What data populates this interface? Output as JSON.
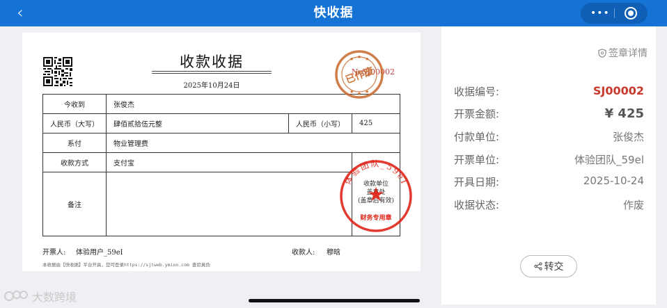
{
  "header": {
    "title": "快收据",
    "back_icon": "‹",
    "more_icon": "•••",
    "colors": {
      "bar": "#1673d6",
      "capsule": "#0f5fb6"
    }
  },
  "receipt": {
    "title": "收款收据",
    "date": "2025年10月24日",
    "number_label": "No",
    "number": "SJ00002",
    "rows": {
      "received_from_label": "今收到",
      "received_from": "张俊杰",
      "amount_upper_label": "人民币（大写）",
      "amount_upper": "肆佰贰拾伍元整",
      "amount_lower_label": "人民币（小写）",
      "amount_lower": "425",
      "for_label": "系付",
      "for_value": "物业管理费",
      "method_label": "收款方式",
      "method_value": "支付宝",
      "remark_label": "备注",
      "seal_note": "收款单位\n盖章处\n(盖章后有效)"
    },
    "issuer_label": "开票人:",
    "issuer": "体验用户_59eI",
    "payee_label": "收款人:",
    "payee": "穆晗",
    "footnote": "本收据由【快收据】平台开具，您可登录https://sjtweb.ymion.com 查验真伪",
    "void_stamp": {
      "text": "已作废"
    },
    "seal": {
      "ring_text": "体验团队_59eI",
      "bottom_text": "财务专用章"
    },
    "colors": {
      "stamp_orange": "#c8692c",
      "seal_red": "#e0251b",
      "number": "#c13b3b"
    }
  },
  "details": {
    "stamp_link": "签章详情",
    "items": [
      {
        "label": "收据编号:",
        "value": "SJ00002"
      },
      {
        "label": "开票金额:",
        "value": "¥ 425"
      },
      {
        "label": "付款单位:",
        "value": "张俊杰"
      },
      {
        "label": "开票单位:",
        "value": "体验团队_59el"
      },
      {
        "label": "开具日期:",
        "value": "2025-10-24"
      },
      {
        "label": "收据状态:",
        "value": "作废"
      }
    ],
    "transfer_button": "转交",
    "colors": {
      "code": "#c8392b"
    }
  },
  "watermark": "大数跨境"
}
